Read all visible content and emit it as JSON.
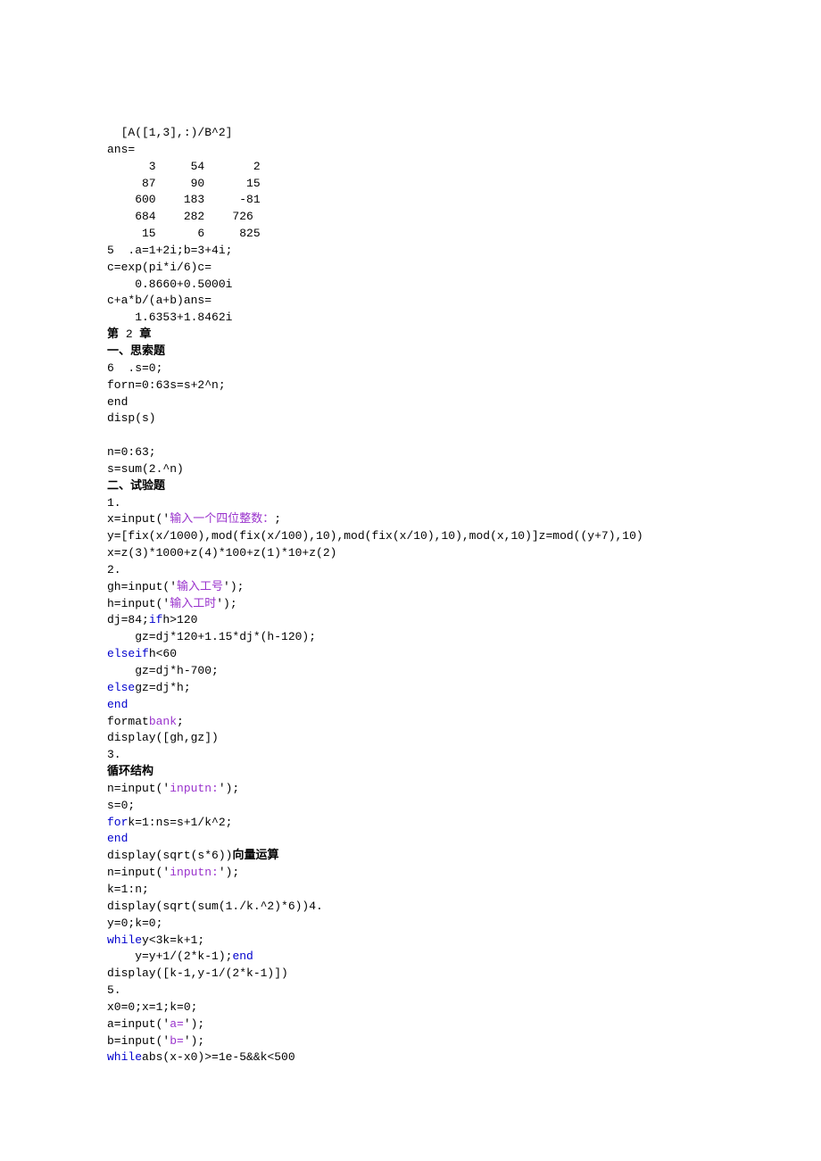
{
  "lines": [
    {
      "segs": [
        {
          "t": "  [A([1,3],:)/B^2]"
        }
      ]
    },
    {
      "segs": [
        {
          "t": "ans="
        }
      ]
    },
    {
      "segs": [
        {
          "t": "      3     54       2"
        }
      ]
    },
    {
      "segs": [
        {
          "t": "     87     90      15"
        }
      ]
    },
    {
      "segs": [
        {
          "t": "    600    183     -81"
        }
      ]
    },
    {
      "segs": [
        {
          "t": "    684    282    726"
        }
      ]
    },
    {
      "segs": [
        {
          "t": "     15      6     825"
        }
      ]
    },
    {
      "segs": [
        {
          "t": "5  .a=1+2i;b=3+4i;"
        }
      ]
    },
    {
      "segs": [
        {
          "t": "c=exp(pi*i/6)c="
        }
      ]
    },
    {
      "segs": [
        {
          "t": "    0.8660+0.5000i"
        }
      ]
    },
    {
      "segs": [
        {
          "t": "c+a*b/(a+b)ans="
        }
      ]
    },
    {
      "segs": [
        {
          "t": "    1.6353+1.8462i"
        }
      ]
    },
    {
      "segs": [
        {
          "t": "第",
          "b": true
        },
        {
          "t": " 2 "
        },
        {
          "t": "章",
          "b": true
        }
      ]
    },
    {
      "segs": [
        {
          "t": "一、思索题",
          "b": true
        }
      ]
    },
    {
      "segs": [
        {
          "t": "6  .s=0;"
        }
      ]
    },
    {
      "segs": [
        {
          "t": "forn=0:63s=s+2^n;"
        }
      ]
    },
    {
      "segs": [
        {
          "t": "end"
        }
      ]
    },
    {
      "segs": [
        {
          "t": "disp(s)"
        }
      ]
    },
    {
      "segs": [
        {
          "t": ""
        }
      ]
    },
    {
      "segs": [
        {
          "t": "n=0:63;"
        }
      ]
    },
    {
      "segs": [
        {
          "t": "s=sum(2.^n)"
        }
      ]
    },
    {
      "segs": [
        {
          "t": "二、试验题",
          "b": true
        }
      ]
    },
    {
      "segs": [
        {
          "t": "1."
        }
      ]
    },
    {
      "segs": [
        {
          "t": "x=input('"
        },
        {
          "t": "输入一个四位整数：",
          "c": "purple"
        },
        {
          "t": ";"
        }
      ]
    },
    {
      "segs": [
        {
          "t": "y=[fix(x/1000),mod(fix(x/100),10),mod(fix(x/10),10),mod(x,10)]z=mod((y+7),10)"
        }
      ]
    },
    {
      "segs": [
        {
          "t": "x=z(3)*1000+z(4)*100+z(1)*10+z(2)"
        }
      ]
    },
    {
      "segs": [
        {
          "t": "2."
        }
      ]
    },
    {
      "segs": [
        {
          "t": "gh=input('"
        },
        {
          "t": "输入工号",
          "c": "purple"
        },
        {
          "t": "');"
        }
      ]
    },
    {
      "segs": [
        {
          "t": "h=input('"
        },
        {
          "t": "输入工时",
          "c": "purple"
        },
        {
          "t": "');"
        }
      ]
    },
    {
      "segs": [
        {
          "t": "dj=84;"
        },
        {
          "t": "if",
          "c": "blue"
        },
        {
          "t": "h>120"
        }
      ]
    },
    {
      "segs": [
        {
          "t": "    gz=dj*120+1.15*dj*(h-120);"
        }
      ]
    },
    {
      "segs": [
        {
          "t": "elseif",
          "c": "blue"
        },
        {
          "t": "h<60"
        }
      ]
    },
    {
      "segs": [
        {
          "t": "    gz=dj*h-700;"
        }
      ]
    },
    {
      "segs": [
        {
          "t": "else",
          "c": "blue"
        },
        {
          "t": "gz=dj*h;"
        }
      ]
    },
    {
      "segs": [
        {
          "t": "end",
          "c": "blue"
        }
      ]
    },
    {
      "segs": [
        {
          "t": "format"
        },
        {
          "t": "bank",
          "c": "purple"
        },
        {
          "t": ";"
        }
      ]
    },
    {
      "segs": [
        {
          "t": "display([gh,gz])"
        }
      ]
    },
    {
      "segs": [
        {
          "t": "3."
        }
      ]
    },
    {
      "segs": [
        {
          "t": "循环结构",
          "b": true
        }
      ]
    },
    {
      "segs": [
        {
          "t": "n=input('"
        },
        {
          "t": "inputn:",
          "c": "purple"
        },
        {
          "t": "');"
        }
      ]
    },
    {
      "segs": [
        {
          "t": "s=0;"
        }
      ]
    },
    {
      "segs": [
        {
          "t": "for",
          "c": "blue"
        },
        {
          "t": "k=1:ns=s+1/k^2;"
        }
      ]
    },
    {
      "segs": [
        {
          "t": "end",
          "c": "blue"
        }
      ]
    },
    {
      "segs": [
        {
          "t": "display(sqrt(s*6))"
        },
        {
          "t": "向量运算",
          "b": true
        }
      ]
    },
    {
      "segs": [
        {
          "t": "n=input('"
        },
        {
          "t": "inputn:",
          "c": "purple"
        },
        {
          "t": "');"
        }
      ]
    },
    {
      "segs": [
        {
          "t": "k=1:n;"
        }
      ]
    },
    {
      "segs": [
        {
          "t": "display(sqrt(sum(1./k.^2)*6))4."
        }
      ]
    },
    {
      "segs": [
        {
          "t": "y=0;k=0;"
        }
      ]
    },
    {
      "segs": [
        {
          "t": "while",
          "c": "blue"
        },
        {
          "t": "y<3k=k+1;"
        }
      ]
    },
    {
      "segs": [
        {
          "t": "    y=y+1/(2*k-1);"
        },
        {
          "t": "end",
          "c": "blue"
        }
      ]
    },
    {
      "segs": [
        {
          "t": "display([k-1,y-1/(2*k-1)])"
        }
      ]
    },
    {
      "segs": [
        {
          "t": "5."
        }
      ]
    },
    {
      "segs": [
        {
          "t": "x0=0;x=1;k=0;"
        }
      ]
    },
    {
      "segs": [
        {
          "t": "a=input('"
        },
        {
          "t": "a=",
          "c": "purple"
        },
        {
          "t": "');"
        }
      ]
    },
    {
      "segs": [
        {
          "t": "b=input('"
        },
        {
          "t": "b=",
          "c": "purple"
        },
        {
          "t": "');"
        }
      ]
    },
    {
      "segs": [
        {
          "t": "while",
          "c": "blue"
        },
        {
          "t": "abs(x-x0)>=1e-5&&k<500"
        }
      ]
    }
  ]
}
